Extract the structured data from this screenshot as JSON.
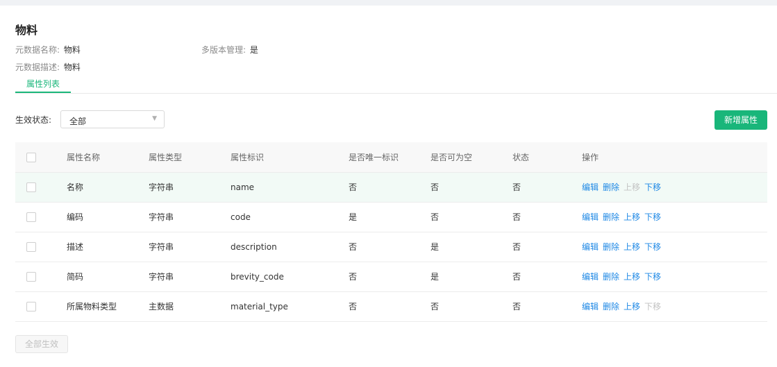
{
  "page": {
    "title": "物料",
    "meta": {
      "name_label": "元数据名称:",
      "name_value": "物料",
      "version_label": "多版本管理:",
      "version_value": "是",
      "desc_label": "元数据描述:",
      "desc_value": "物料"
    },
    "tab_label": "属性列表"
  },
  "filter": {
    "label": "生效状态:",
    "selected": "全部"
  },
  "toolbar": {
    "add_label": "新增属性"
  },
  "table": {
    "columns": [
      "属性名称",
      "属性类型",
      "属性标识",
      "是否唯一标识",
      "是否可为空",
      "状态",
      "操作"
    ],
    "rows": [
      {
        "name": "名称",
        "type": "字符串",
        "key": "name",
        "unique": "否",
        "nullable": "否",
        "status": "否",
        "actions": [
          {
            "label": "编辑",
            "enabled": true
          },
          {
            "label": "删除",
            "enabled": true
          },
          {
            "label": "上移",
            "enabled": false
          },
          {
            "label": "下移",
            "enabled": true
          }
        ],
        "highlight": true
      },
      {
        "name": "编码",
        "type": "字符串",
        "key": "code",
        "unique": "是",
        "nullable": "否",
        "status": "否",
        "actions": [
          {
            "label": "编辑",
            "enabled": true
          },
          {
            "label": "删除",
            "enabled": true
          },
          {
            "label": "上移",
            "enabled": true
          },
          {
            "label": "下移",
            "enabled": true
          }
        ],
        "highlight": false
      },
      {
        "name": "描述",
        "type": "字符串",
        "key": "description",
        "unique": "否",
        "nullable": "是",
        "status": "否",
        "actions": [
          {
            "label": "编辑",
            "enabled": true
          },
          {
            "label": "删除",
            "enabled": true
          },
          {
            "label": "上移",
            "enabled": true
          },
          {
            "label": "下移",
            "enabled": true
          }
        ],
        "highlight": false
      },
      {
        "name": "简码",
        "type": "字符串",
        "key": "brevity_code",
        "unique": "否",
        "nullable": "是",
        "status": "否",
        "actions": [
          {
            "label": "编辑",
            "enabled": true
          },
          {
            "label": "删除",
            "enabled": true
          },
          {
            "label": "上移",
            "enabled": true
          },
          {
            "label": "下移",
            "enabled": true
          }
        ],
        "highlight": false
      },
      {
        "name": "所属物料类型",
        "type": "主数据",
        "key": "material_type",
        "unique": "否",
        "nullable": "否",
        "status": "否",
        "actions": [
          {
            "label": "编辑",
            "enabled": true
          },
          {
            "label": "删除",
            "enabled": true
          },
          {
            "label": "上移",
            "enabled": true
          },
          {
            "label": "下移",
            "enabled": false
          }
        ],
        "highlight": false
      }
    ]
  },
  "footer": {
    "apply_all_label": "全部生效"
  },
  "colors": {
    "accent": "#19b67a",
    "link": "#1e88e5",
    "disabled": "#c2c2c2",
    "row_highlight": "#f2faf6"
  }
}
